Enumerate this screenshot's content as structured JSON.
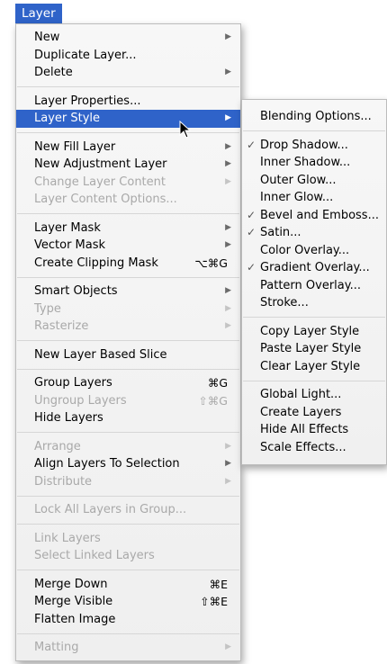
{
  "menubar": {
    "title": "Layer"
  },
  "menu": [
    {
      "label": "New",
      "arrow": true
    },
    {
      "label": "Duplicate Layer..."
    },
    {
      "label": "Delete",
      "arrow": true
    },
    {
      "sep": true
    },
    {
      "label": "Layer Properties..."
    },
    {
      "label": "Layer Style",
      "arrow": true,
      "selected": true
    },
    {
      "sep": true
    },
    {
      "label": "New Fill Layer",
      "arrow": true
    },
    {
      "label": "New Adjustment Layer",
      "arrow": true
    },
    {
      "label": "Change Layer Content",
      "arrow": true,
      "disabled": true
    },
    {
      "label": "Layer Content Options...",
      "disabled": true
    },
    {
      "sep": true
    },
    {
      "label": "Layer Mask",
      "arrow": true
    },
    {
      "label": "Vector Mask",
      "arrow": true
    },
    {
      "label": "Create Clipping Mask",
      "shortcut": "⌥⌘G"
    },
    {
      "sep": true
    },
    {
      "label": "Smart Objects",
      "arrow": true
    },
    {
      "label": "Type",
      "arrow": true,
      "disabled": true
    },
    {
      "label": "Rasterize",
      "arrow": true,
      "disabled": true
    },
    {
      "sep": true
    },
    {
      "label": "New Layer Based Slice"
    },
    {
      "sep": true
    },
    {
      "label": "Group Layers",
      "shortcut": "⌘G"
    },
    {
      "label": "Ungroup Layers",
      "shortcut": "⇧⌘G",
      "disabled": true
    },
    {
      "label": "Hide Layers"
    },
    {
      "sep": true
    },
    {
      "label": "Arrange",
      "arrow": true,
      "disabled": true
    },
    {
      "label": "Align Layers To Selection",
      "arrow": true
    },
    {
      "label": "Distribute",
      "arrow": true,
      "disabled": true
    },
    {
      "sep": true
    },
    {
      "label": "Lock All Layers in Group...",
      "disabled": true
    },
    {
      "sep": true
    },
    {
      "label": "Link Layers",
      "disabled": true
    },
    {
      "label": "Select Linked Layers",
      "disabled": true
    },
    {
      "sep": true
    },
    {
      "label": "Merge Down",
      "shortcut": "⌘E"
    },
    {
      "label": "Merge Visible",
      "shortcut": "⇧⌘E"
    },
    {
      "label": "Flatten Image"
    },
    {
      "sep": true
    },
    {
      "label": "Matting",
      "arrow": true,
      "disabled": true
    }
  ],
  "submenu": [
    {
      "label": "Blending Options..."
    },
    {
      "sep": true
    },
    {
      "label": "Drop Shadow...",
      "checked": true
    },
    {
      "label": "Inner Shadow..."
    },
    {
      "label": "Outer Glow..."
    },
    {
      "label": "Inner Glow..."
    },
    {
      "label": "Bevel and Emboss...",
      "checked": true
    },
    {
      "label": "Satin...",
      "checked": true
    },
    {
      "label": "Color Overlay..."
    },
    {
      "label": "Gradient Overlay...",
      "checked": true
    },
    {
      "label": "Pattern Overlay..."
    },
    {
      "label": "Stroke..."
    },
    {
      "sep": true
    },
    {
      "label": "Copy Layer Style"
    },
    {
      "label": "Paste Layer Style"
    },
    {
      "label": "Clear Layer Style"
    },
    {
      "sep": true
    },
    {
      "label": "Global Light..."
    },
    {
      "label": "Create Layers"
    },
    {
      "label": "Hide All Effects"
    },
    {
      "label": "Scale Effects..."
    }
  ],
  "icons": {
    "arrow": "submenu-arrow-icon",
    "check": "checkmark-icon",
    "cursor": "pointer-cursor-icon"
  },
  "colors": {
    "highlight": "#2f63c9",
    "disabled": "#a9a9a9"
  }
}
